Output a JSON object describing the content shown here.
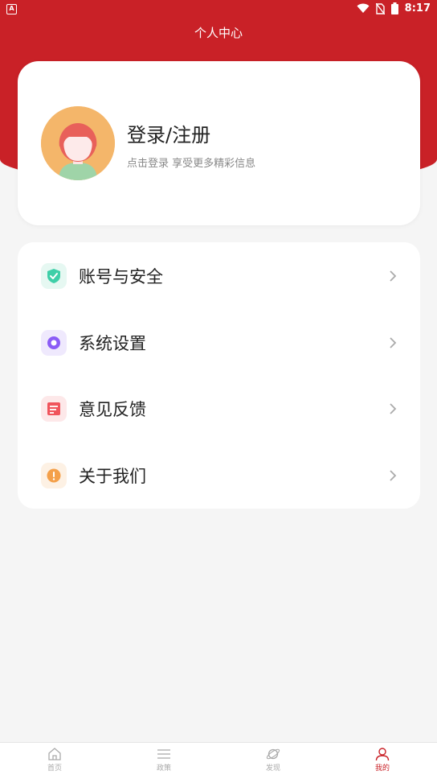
{
  "status_bar": {
    "left_badge": "A",
    "time": "8:17"
  },
  "header": {
    "title": "个人中心"
  },
  "profile": {
    "title": "登录/注册",
    "subtitle": "点击登录 享受更多精彩信息"
  },
  "menu": {
    "items": [
      {
        "label": "账号与安全",
        "icon": "shield-check-icon",
        "color": "#3ecfa8"
      },
      {
        "label": "系统设置",
        "icon": "settings-ring-icon",
        "color": "#8b5cf6"
      },
      {
        "label": "意见反馈",
        "icon": "feedback-doc-icon",
        "color": "#f0545c"
      },
      {
        "label": "关于我们",
        "icon": "info-circle-icon",
        "color": "#f4a04a"
      }
    ]
  },
  "tabbar": {
    "tabs": [
      {
        "label": "首页",
        "icon": "home-icon"
      },
      {
        "label": "政策",
        "icon": "list-icon"
      },
      {
        "label": "发现",
        "icon": "planet-icon"
      },
      {
        "label": "我的",
        "icon": "person-icon",
        "active": true
      }
    ]
  },
  "colors": {
    "brand": "#c92127",
    "background": "#f5f5f5"
  }
}
